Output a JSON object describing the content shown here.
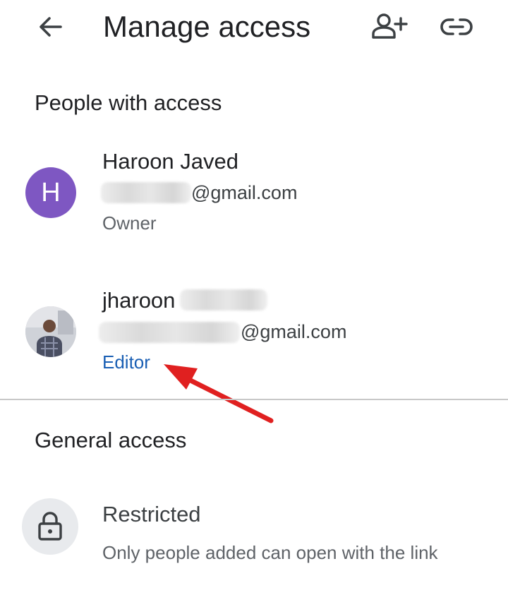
{
  "header": {
    "title": "Manage access",
    "back_icon": "arrow-back-icon",
    "add_person_icon": "person-add-icon",
    "link_icon": "link-icon"
  },
  "people_section": {
    "title": "People with access",
    "people": [
      {
        "initial": "H",
        "name": "Haroon Javed",
        "email_suffix": "@gmail.com",
        "role": "Owner",
        "avatar_color": "#7e57c2"
      },
      {
        "name": "jharoon",
        "email_suffix": "@gmail.com",
        "role": "Editor",
        "role_color": "#1a5fb4"
      }
    ]
  },
  "general_section": {
    "title": "General access",
    "setting": "Restricted",
    "description": "Only people added can open with the link",
    "icon": "lock-icon"
  },
  "annotation": {
    "type": "red-arrow",
    "color": "#e02020"
  }
}
